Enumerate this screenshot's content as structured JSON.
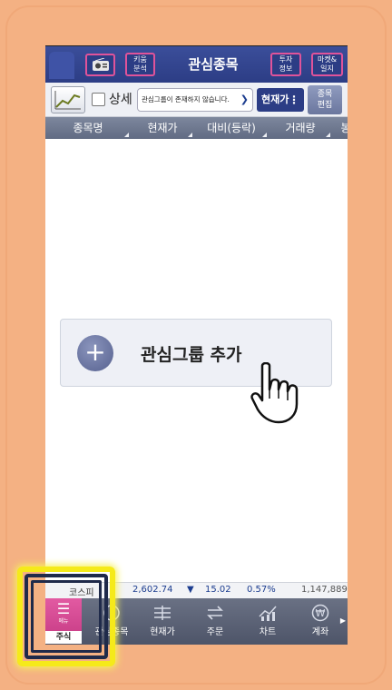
{
  "header": {
    "title": "관심종목",
    "kiwoom_label": "키움\n분석",
    "invest_label": "투자\n정보",
    "market_label": "마켓&\n일지"
  },
  "toolbar": {
    "detail_label": "상세",
    "group_select_value": "관심그룹이 존재하지 않습니다.",
    "price_label": "현재가",
    "edit_label": "종목\n편집"
  },
  "columns": [
    "종목명",
    "현재가",
    "대비(등락)",
    "거래량",
    "봉"
  ],
  "add_group": {
    "label": "관심그룹 추가"
  },
  "ticker": {
    "index_name": "코스피",
    "value": "2,602.74",
    "change": "15.02",
    "rate": "0.57%",
    "volume": "1,147,889"
  },
  "nav": {
    "menu_label": "메뉴",
    "stock_label": "주식",
    "items": [
      "관심종목",
      "현재가",
      "주문",
      "차트",
      "계좌"
    ]
  },
  "colors": {
    "header_bg": "#2c3d85",
    "accent_pink": "#e0539a",
    "highlight_yellow": "#f5ea1a",
    "background": "#f4b183"
  }
}
